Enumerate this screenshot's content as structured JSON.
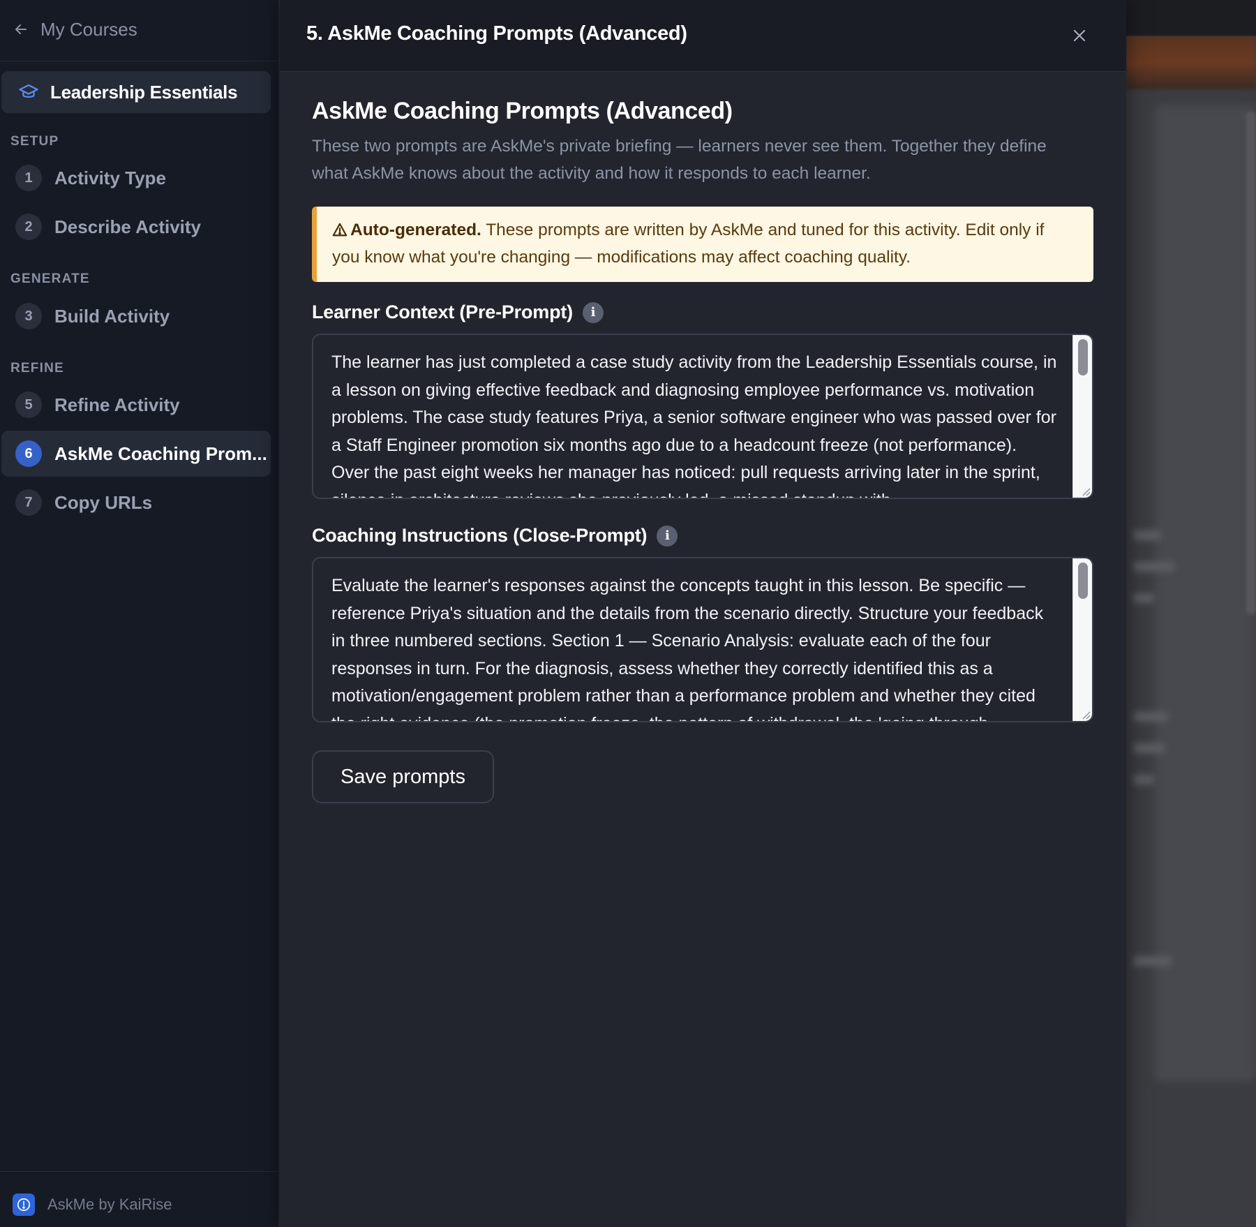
{
  "colors": {
    "sidebar_bg": "#161a24",
    "panel_bg": "#22252e",
    "accent_blue": "#3462c8",
    "warning_border": "#e7a23a",
    "warning_bg": "#fdf7e3"
  },
  "sidebar": {
    "back_label": "My Courses",
    "back_icon": "arrow-left-icon",
    "course": {
      "label": "Leadership Essentials",
      "icon": "graduation-cap-icon"
    },
    "sections": [
      {
        "label": "SETUP"
      },
      {
        "label": "GENERATE"
      },
      {
        "label": "REFINE"
      }
    ],
    "steps": [
      {
        "num": "1",
        "label": "Activity Type"
      },
      {
        "num": "2",
        "label": "Describe Activity"
      },
      {
        "num": "3",
        "label": "Build Activity"
      },
      {
        "num": "5",
        "label": "Refine Activity"
      },
      {
        "num": "6",
        "label": "AskMe Coaching Prom...",
        "active": true
      },
      {
        "num": "7",
        "label": "Copy URLs"
      }
    ],
    "brand": "AskMe by KaiRise"
  },
  "panel": {
    "title": "5. AskMe Coaching Prompts (Advanced)",
    "close_icon": "close-icon",
    "heading": "AskMe Coaching Prompts (Advanced)",
    "description": "These two prompts are AskMe's private briefing — learners never see them. Together they define what AskMe knows about the activity and how it responds to each learner.",
    "alert": {
      "icon": "warning-icon",
      "strong": "Auto-generated.",
      "text": " These prompts are written by AskMe and tuned for this activity. Edit only if you know what you're changing — modifications may affect coaching quality."
    },
    "pre_prompt": {
      "label": "Learner Context (Pre-Prompt)",
      "value": "The learner has just completed a case study activity from the Leadership Essentials course, in a lesson on giving effective feedback and diagnosing employee performance vs. motivation problems. The case study features Priya, a senior software engineer who was passed over for a Staff Engineer promotion six months ago due to a headcount freeze (not performance). Over the past eight weeks her manager has noticed: pull requests arriving later in the sprint, silence in architecture reviews she previously led, a missed standup with"
    },
    "close_prompt": {
      "label": "Coaching Instructions (Close-Prompt)",
      "value": "Evaluate the learner's responses against the concepts taught in this lesson. Be specific — reference Priya's situation and the details from the scenario directly. Structure your feedback in three numbered sections. Section 1 — Scenario Analysis: evaluate each of the four responses in turn. For the diagnosis, assess whether they correctly identified this as a motivation/engagement problem rather than a performance problem and whether they cited the right evidence (the promotion freeze, the pattern of withdrawal, the 'going through"
    },
    "save_label": "Save prompts"
  }
}
